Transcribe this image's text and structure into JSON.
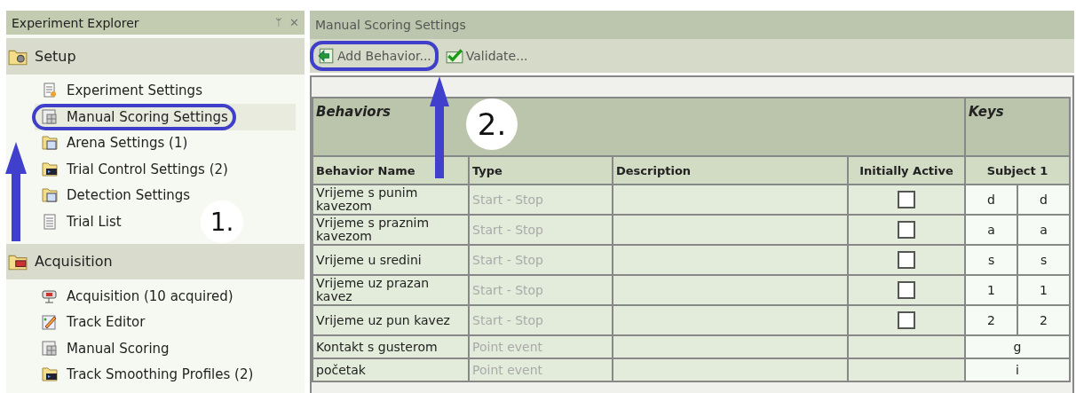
{
  "explorer": {
    "title": "Experiment Explorer",
    "pin": "ᛘ",
    "close": "✕",
    "groups": [
      {
        "label": "Setup",
        "items": [
          {
            "label": "Experiment Settings",
            "selected": false,
            "highlighted": false
          },
          {
            "label": "Manual Scoring Settings",
            "selected": true,
            "highlighted": true
          },
          {
            "label": "Arena Settings (1)",
            "selected": false,
            "highlighted": false
          },
          {
            "label": "Trial Control Settings (2)",
            "selected": false,
            "highlighted": false
          },
          {
            "label": "Detection Settings",
            "selected": false,
            "highlighted": false
          },
          {
            "label": "Trial List",
            "selected": false,
            "highlighted": false
          }
        ]
      },
      {
        "label": "Acquisition",
        "items": [
          {
            "label": "Acquisition (10 acquired)",
            "selected": false,
            "highlighted": false
          },
          {
            "label": "Track Editor",
            "selected": false,
            "highlighted": false
          },
          {
            "label": "Manual Scoring",
            "selected": false,
            "highlighted": false
          },
          {
            "label": "Track Smoothing Profiles (2)",
            "selected": false,
            "highlighted": false
          }
        ]
      }
    ]
  },
  "editor": {
    "title": "Manual Scoring Settings",
    "toolbar": [
      {
        "label": "Add Behavior...",
        "highlighted": true
      },
      {
        "label": "Validate...",
        "highlighted": false
      }
    ],
    "table": {
      "group_headers": [
        "Behaviors",
        "Keys"
      ],
      "columns": [
        "Behavior Name",
        "Type",
        "Description",
        "Initially Active",
        "Subject 1"
      ],
      "rows": [
        {
          "name": "Vrijeme s punim kavezom",
          "type": "Start - Stop",
          "kind": "start_stop",
          "initially_active": false,
          "keys": [
            "d",
            "d"
          ]
        },
        {
          "name": "Vrijeme s praznim kavezom",
          "type": "Start - Stop",
          "kind": "start_stop",
          "initially_active": false,
          "keys": [
            "a",
            "a"
          ]
        },
        {
          "name": "Vrijeme u sredini",
          "type": "Start - Stop",
          "kind": "start_stop",
          "initially_active": false,
          "keys": [
            "s",
            "s"
          ]
        },
        {
          "name": "Vrijeme uz prazan kavez",
          "type": "Start - Stop",
          "kind": "start_stop",
          "initially_active": false,
          "keys": [
            "1",
            "1"
          ]
        },
        {
          "name": "Vrijeme uz pun kavez",
          "type": "Start - Stop",
          "kind": "start_stop",
          "initially_active": false,
          "keys": [
            "2",
            "2"
          ]
        },
        {
          "name": "Kontakt s gusterom",
          "type": "Point event",
          "kind": "point",
          "keys": [
            "g"
          ]
        },
        {
          "name": "početak",
          "type": "Point event",
          "kind": "point",
          "keys": [
            "i"
          ]
        }
      ]
    }
  },
  "callouts": [
    {
      "label": "1."
    },
    {
      "label": "2."
    }
  ]
}
